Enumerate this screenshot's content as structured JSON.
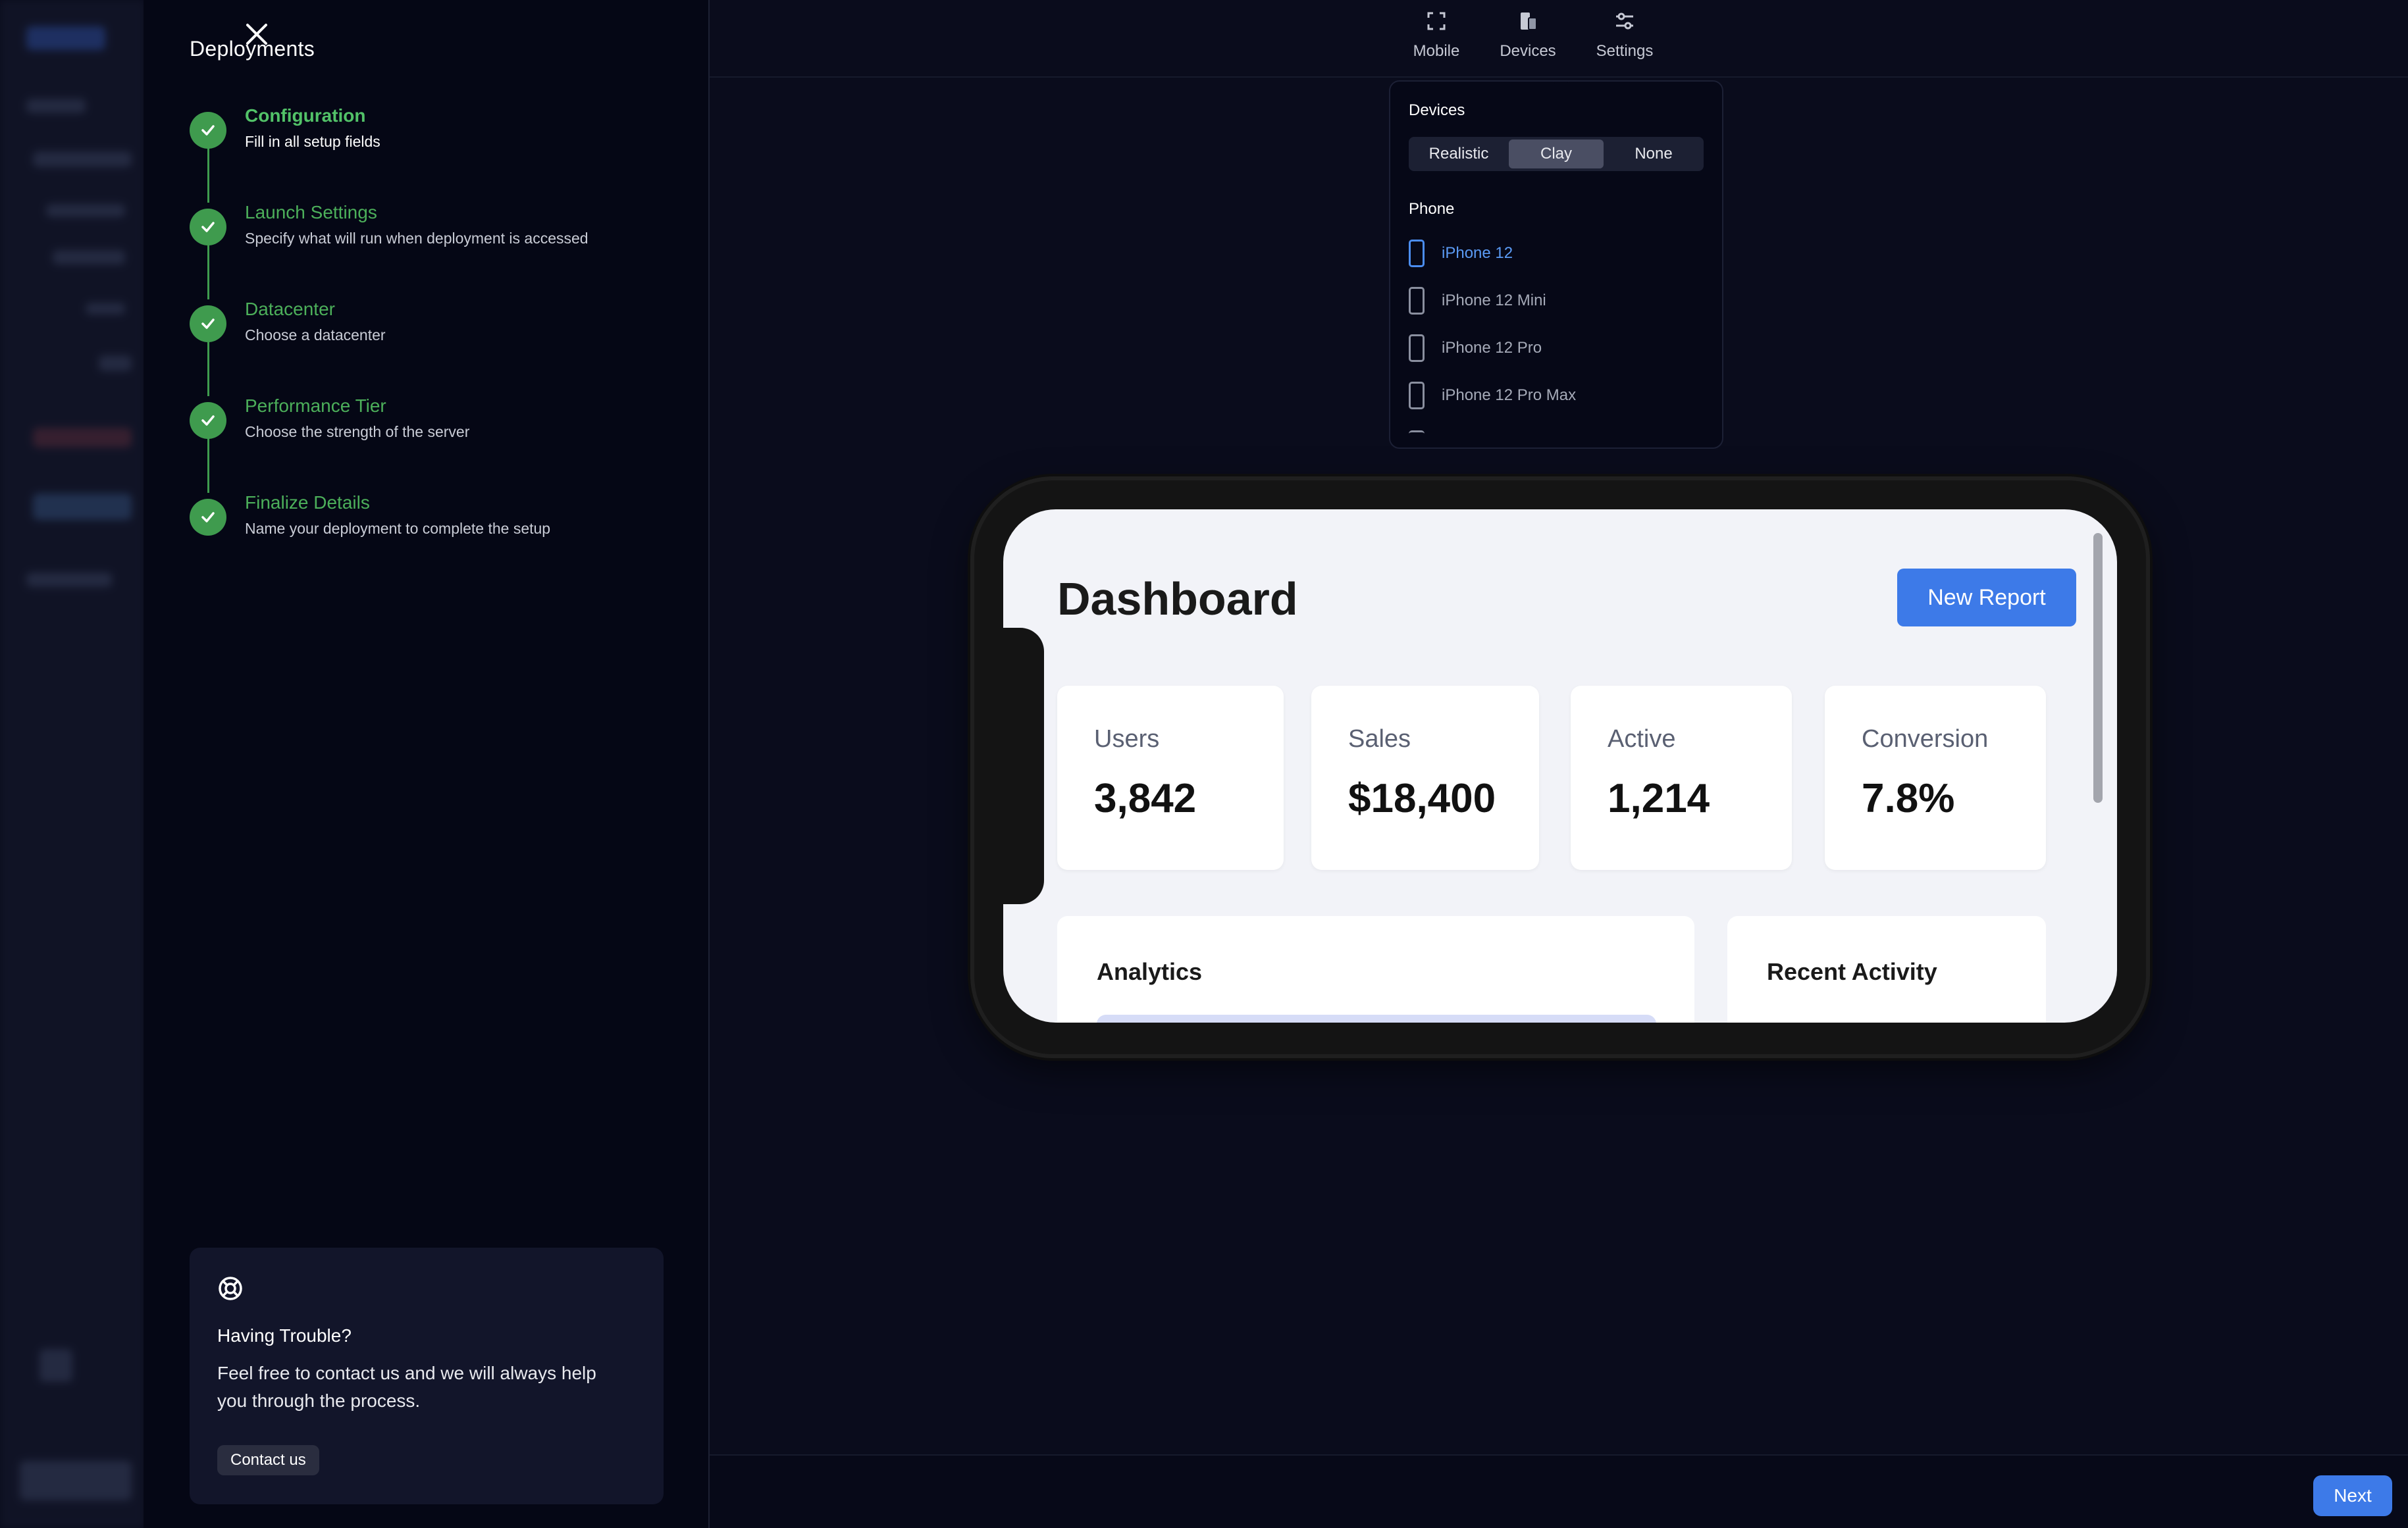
{
  "panel": {
    "title": "Deployments",
    "steps": [
      {
        "title": "Configuration",
        "description": "Fill in all setup fields"
      },
      {
        "title": "Launch Settings",
        "description": "Specify what will run when deployment is accessed"
      },
      {
        "title": "Datacenter",
        "description": "Choose a datacenter"
      },
      {
        "title": "Performance Tier",
        "description": "Choose the strength of the server"
      },
      {
        "title": "Finalize Details",
        "description": "Name your deployment to complete the setup"
      }
    ],
    "help": {
      "title": "Having Trouble?",
      "text": "Feel free to contact us and we will always help you through the process.",
      "button": "Contact us"
    }
  },
  "toolbar": {
    "tabs": [
      {
        "label": "Mobile",
        "icon": "scan-icon"
      },
      {
        "label": "Devices",
        "icon": "devices-icon"
      },
      {
        "label": "Settings",
        "icon": "sliders-icon"
      }
    ]
  },
  "devices_menu": {
    "heading": "Devices",
    "frame_options": [
      "Realistic",
      "Clay",
      "None"
    ],
    "selected_frame": "Clay",
    "phone_heading": "Phone",
    "phones": [
      "iPhone 12",
      "iPhone 12 Mini",
      "iPhone 12 Pro",
      "iPhone 12 Pro Max"
    ],
    "selected_phone": "iPhone 12"
  },
  "preview": {
    "title": "Dashboard",
    "new_report": "New Report",
    "stats": [
      {
        "label": "Users",
        "value": "3,842"
      },
      {
        "label": "Sales",
        "value": "$18,400"
      },
      {
        "label": "Active",
        "value": "1,214"
      },
      {
        "label": "Conversion",
        "value": "7.8%"
      }
    ],
    "sections": [
      "Analytics",
      "Recent Activity"
    ]
  },
  "footer": {
    "next": "Next"
  },
  "colors": {
    "accent": "#3d7ae8",
    "success": "#3f9b4e",
    "panel_bg": "#050715"
  }
}
